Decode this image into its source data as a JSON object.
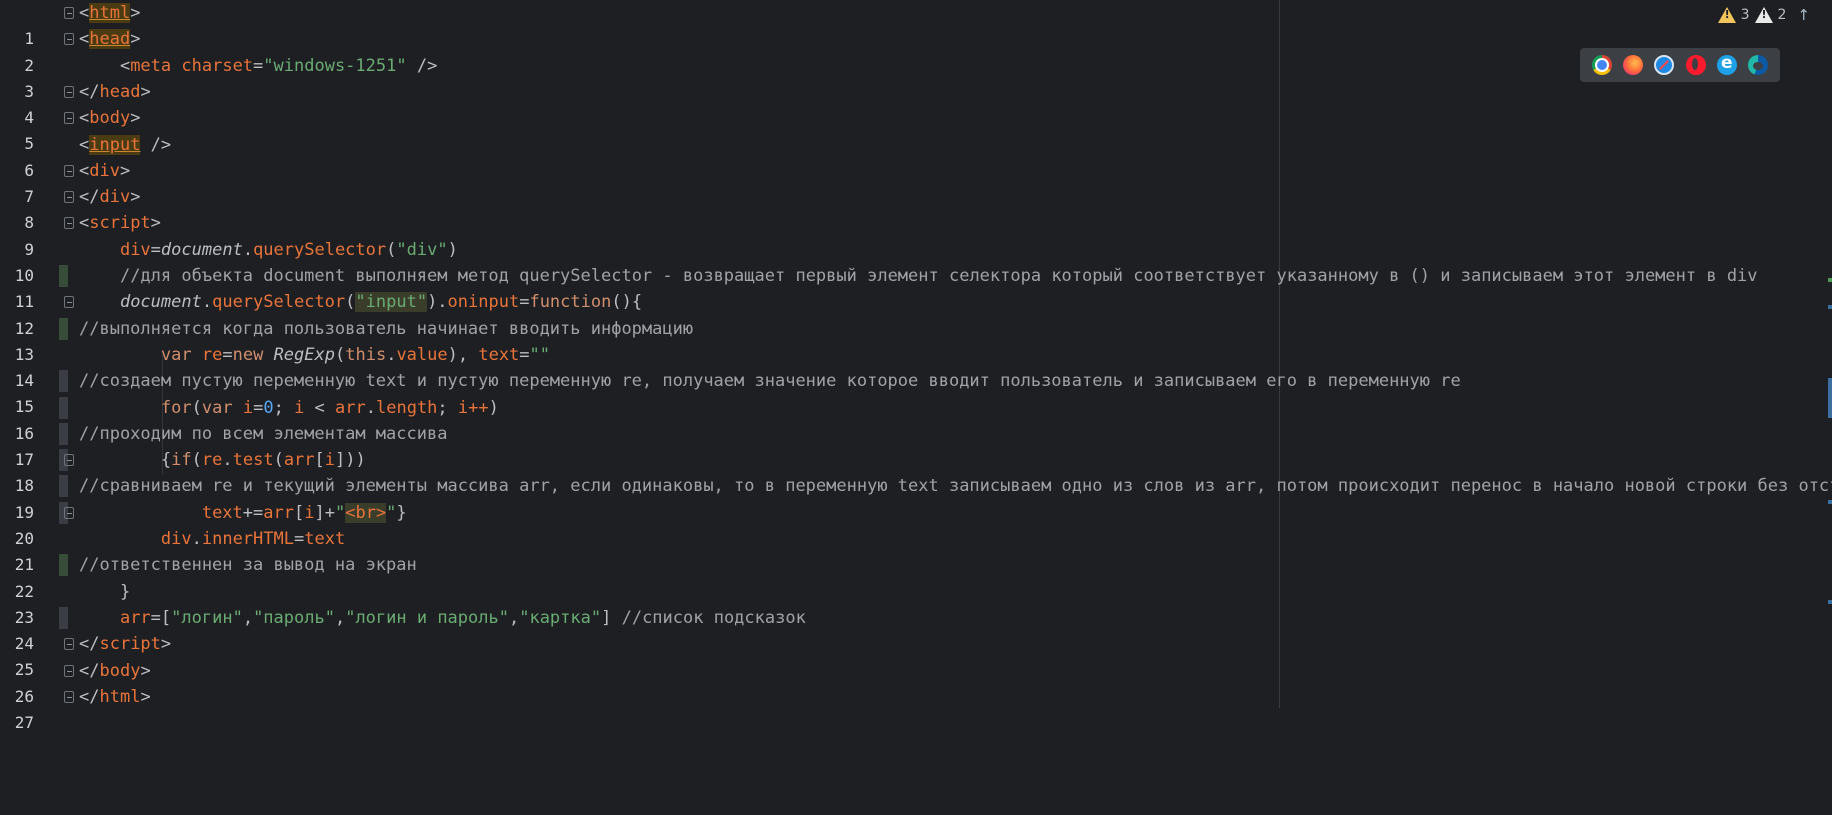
{
  "editor": {
    "lines": [
      {
        "n": "1"
      },
      {
        "n": "2"
      },
      {
        "n": "3"
      },
      {
        "n": "4"
      },
      {
        "n": "5"
      },
      {
        "n": "6"
      },
      {
        "n": "7"
      },
      {
        "n": "8"
      },
      {
        "n": "9"
      },
      {
        "n": "10"
      },
      {
        "n": "11"
      },
      {
        "n": "12"
      },
      {
        "n": "13"
      },
      {
        "n": "14"
      },
      {
        "n": "15"
      },
      {
        "n": "16"
      },
      {
        "n": "17"
      },
      {
        "n": "18"
      },
      {
        "n": "19"
      },
      {
        "n": "20"
      },
      {
        "n": "21"
      },
      {
        "n": "22"
      },
      {
        "n": "23"
      },
      {
        "n": "24"
      },
      {
        "n": "25"
      },
      {
        "n": "26"
      },
      {
        "n": "27"
      }
    ],
    "code": {
      "l1_tag": "html",
      "l2_tag": "head",
      "l3_meta": "meta",
      "l3_attr": "charset",
      "l3_val": "\"windows-1251\"",
      "l4_tag": "head",
      "l5_tag": "body",
      "l6_tag": "input",
      "l7_tag": "div",
      "l8_tag": "div",
      "l9_tag": "script",
      "l10_a": "div",
      "l10_b": "document",
      "l10_c": "querySelector",
      "l10_d": "\"div\"",
      "l11_comment": "//для объекта document выполняем метод querySelector - возвращает первый элемент селектора который соответствует указанному в () и записываем этот элемент в div",
      "l12_a": "document",
      "l12_b": "querySelector",
      "l12_c": "\"input\"",
      "l12_d": "oninput",
      "l12_e": "function",
      "l13_comment": "//выполняется когда пользователь начинает вводить информацию",
      "l14_var": "var",
      "l14_re": "re",
      "l14_new": "new",
      "l14_regexp": "RegExp",
      "l14_this": "this",
      "l14_value": "value",
      "l14_text": "text",
      "l14_str": "\"\"",
      "l15_comment": "//создаем пустую переменную text и пустую переменную re, получаем значение которое вводит пользователь и записываем его в переменную re",
      "l16_for": "for",
      "l16_var": "var",
      "l16_i": "i",
      "l16_zero": "0",
      "l16_i2": "i",
      "l16_arr": "arr",
      "l16_length": "length",
      "l16_i3": "i++",
      "l17_comment": "//проходим по всем элементам массива",
      "l18_if": "if",
      "l18_re": "re",
      "l18_test": "test",
      "l18_arr": "arr",
      "l18_i": "i",
      "l19_comment": "//сравниваем re и текущий элементы массива arr, если одинаковы, то в переменную text записываем одно из слов из arr, потом происходит перенос в начало новой строки без отступа",
      "l20_text": "text",
      "l20_arr": "arr",
      "l20_i": "i",
      "l20_q1": "\"",
      "l20_br": "<br>",
      "l20_q2": "\"",
      "l21_div": "div",
      "l21_inner": "innerHTML",
      "l21_text": "text",
      "l22_comment": "//ответственнен за вывод на экран",
      "l23_brace": "}",
      "l24_arr": "arr",
      "l24_s1": "\"логин\"",
      "l24_s2": "\"пароль\"",
      "l24_s3": "\"логин и пароль\"",
      "l24_s4": "\"картка\"",
      "l24_comment": "//список подсказок",
      "l25_tag": "script",
      "l26_tag": "body",
      "l27_tag": "html"
    }
  },
  "inspections": {
    "warnings_count": "3",
    "weak_warnings_count": "2"
  },
  "browsers": [
    "chrome-icon",
    "firefox-icon",
    "safari-icon",
    "opera-icon",
    "ie-icon",
    "edge-icon"
  ]
}
